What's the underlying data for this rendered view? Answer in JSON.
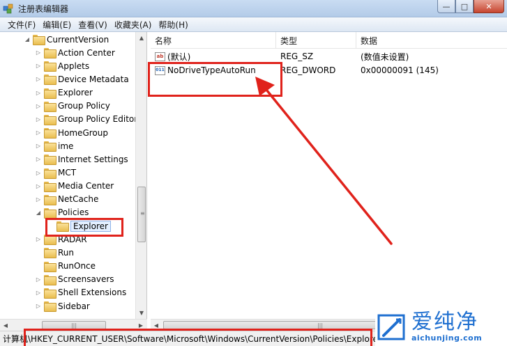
{
  "window": {
    "title": "注册表编辑器",
    "minimize": "—",
    "maximize": "□",
    "close": "✕"
  },
  "menu": [
    "文件(F)",
    "编辑(E)",
    "查看(V)",
    "收藏夹(A)",
    "帮助(H)"
  ],
  "tree": [
    {
      "label": "CurrentVersion",
      "expander": "◢",
      "level": 0
    },
    {
      "label": "Action Center",
      "expander": "▷",
      "level": 1
    },
    {
      "label": "Applets",
      "expander": "▷",
      "level": 1
    },
    {
      "label": "Device Metadata",
      "expander": "▷",
      "level": 1
    },
    {
      "label": "Explorer",
      "expander": "▷",
      "level": 1
    },
    {
      "label": "Group Policy",
      "expander": "▷",
      "level": 1
    },
    {
      "label": "Group Policy Editor",
      "expander": "▷",
      "level": 1
    },
    {
      "label": "HomeGroup",
      "expander": "▷",
      "level": 1
    },
    {
      "label": "ime",
      "expander": "▷",
      "level": 1
    },
    {
      "label": "Internet Settings",
      "expander": "▷",
      "level": 1
    },
    {
      "label": "MCT",
      "expander": "▷",
      "level": 1
    },
    {
      "label": "Media Center",
      "expander": "▷",
      "level": 1
    },
    {
      "label": "NetCache",
      "expander": "▷",
      "level": 1
    },
    {
      "label": "Policies",
      "expander": "◢",
      "level": 1
    },
    {
      "label": "Explorer",
      "expander": "",
      "level": 2,
      "selected": true
    },
    {
      "label": "RADAR",
      "expander": "▷",
      "level": 1
    },
    {
      "label": "Run",
      "expander": "",
      "level": 1
    },
    {
      "label": "RunOnce",
      "expander": "",
      "level": 1
    },
    {
      "label": "Screensavers",
      "expander": "▷",
      "level": 1
    },
    {
      "label": "Shell Extensions",
      "expander": "▷",
      "level": 1
    },
    {
      "label": "Sidebar",
      "expander": "▷",
      "level": 1
    }
  ],
  "columns": {
    "name": "名称",
    "type": "类型",
    "data": "数据"
  },
  "values": [
    {
      "icon": "ab",
      "icon_name": "string-value-icon",
      "name": "(默认)",
      "type": "REG_SZ",
      "data": "(数值未设置)"
    },
    {
      "icon": "011\n110",
      "icon_name": "dword-value-icon",
      "name": "NoDriveTypeAutoRun",
      "type": "REG_DWORD",
      "data": "0x00000091 (145)"
    }
  ],
  "status": {
    "path": "计算机\\HKEY_CURRENT_USER\\Software\\Microsoft\\Windows\\CurrentVersion\\Policies\\Explorer"
  },
  "watermark": {
    "brand": "爱纯净",
    "url": "aichunjing.com"
  },
  "colors": {
    "annotation": "#e0221b",
    "watermark": "#1e6fd0"
  }
}
